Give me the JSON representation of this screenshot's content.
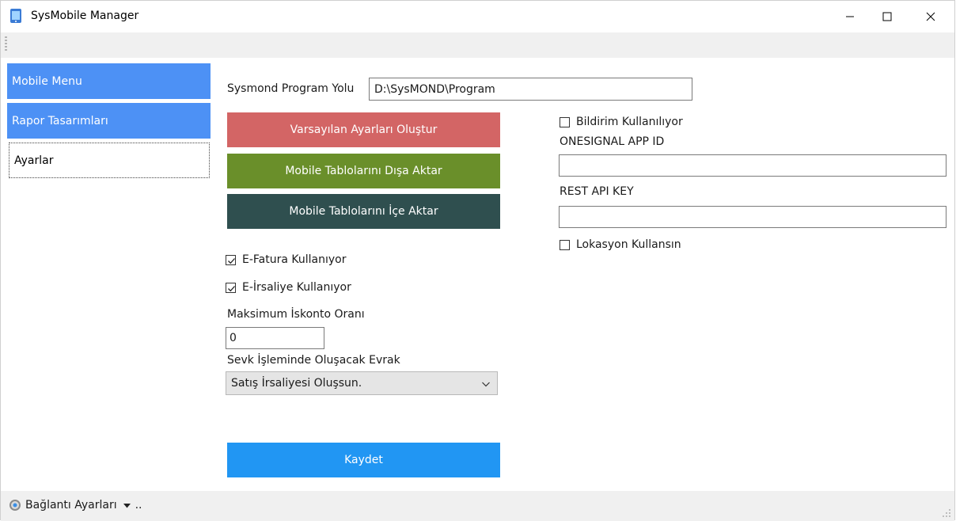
{
  "window": {
    "title": "SysMobile Manager"
  },
  "sidebar": {
    "items": [
      {
        "label": "Mobile Menu"
      },
      {
        "label": "Rapor Tasarımları"
      },
      {
        "label": "Ayarlar"
      }
    ]
  },
  "main": {
    "program_path_label": "Sysmond Program Yolu",
    "program_path_value": "D:\\SysMOND\\Program",
    "buttons": {
      "defaults": "Varsayılan Ayarları Oluştur",
      "export": "Mobile Tablolarını Dışa Aktar",
      "import": "Mobile Tablolarını İçe Aktar",
      "save": "Kaydet"
    },
    "efatura_label": "E-Fatura Kullanıyor",
    "efatura_checked": true,
    "eirsaliye_label": "E-İrsaliye Kullanıyor",
    "eirsaliye_checked": true,
    "max_discount_label": "Maksimum İskonto Oranı",
    "max_discount_value": "0",
    "dispatch_doc_label": "Sevk İşleminde Oluşacak Evrak",
    "dispatch_doc_selected": "Satış İrsaliyesi Oluşsun.",
    "notification_label": "Bildirim Kullanılıyor",
    "notification_checked": false,
    "onesignal_label": "ONESIGNAL APP ID",
    "onesignal_value": "",
    "rest_api_label": "REST API KEY",
    "rest_api_value": "",
    "location_label": "Lokasyon Kullansın",
    "location_checked": false
  },
  "statusbar": {
    "connection_label": "Bağlantı Ayarları",
    "ellipsis": ".."
  },
  "colors": {
    "sidebar_active": "#4d91f5",
    "defaults_btn": "#d36565",
    "export_btn": "#6a8f2a",
    "import_btn": "#2f4f4f",
    "save_btn": "#2196f3"
  }
}
